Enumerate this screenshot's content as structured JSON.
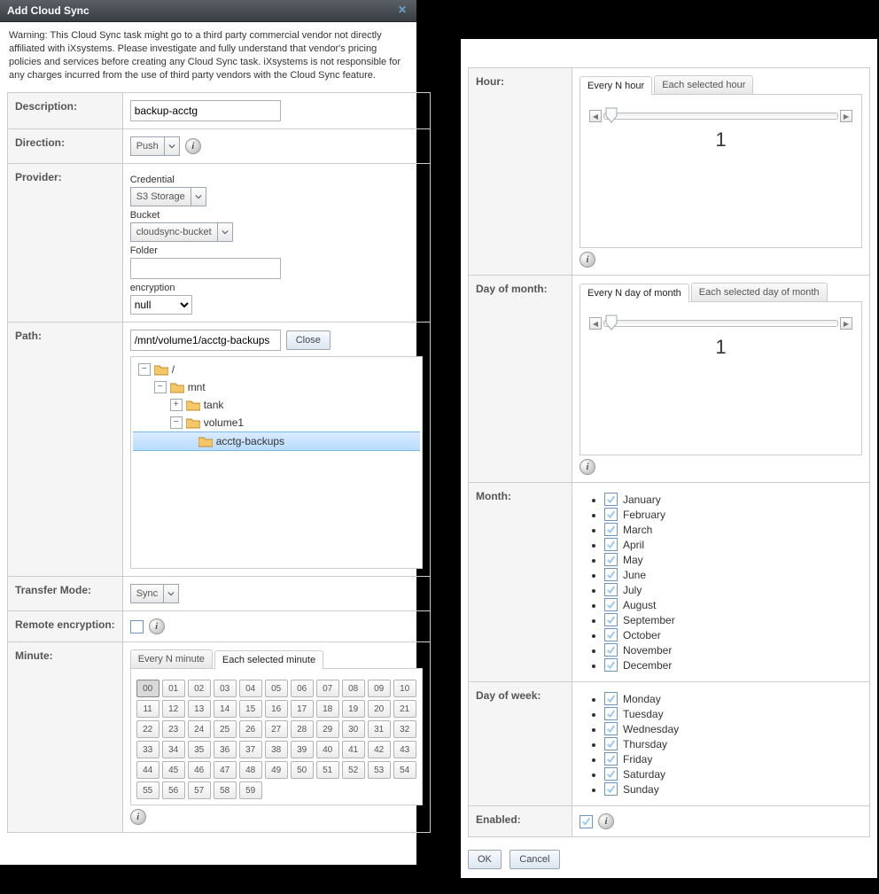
{
  "title": "Add Cloud Sync",
  "warning": "Warning: This Cloud Sync task might go to a third party commercial vendor not directly affiliated with iXsystems. Please investigate and fully understand that vendor's pricing policies and services before creating any Cloud Sync task. iXsystems is not responsible for any charges incurred from the use of third party vendors with the Cloud Sync feature.",
  "labels": {
    "description": "Description:",
    "direction": "Direction:",
    "provider": "Provider:",
    "path": "Path:",
    "transfer": "Transfer Mode:",
    "remote_enc": "Remote encryption:",
    "minute": "Minute:",
    "hour": "Hour:",
    "dom": "Day of month:",
    "month": "Month:",
    "dow": "Day of week:",
    "enabled": "Enabled:"
  },
  "provider": {
    "credential_label": "Credential",
    "credential_value": "S3 Storage",
    "bucket_label": "Bucket",
    "bucket_value": "cloudsync-bucket",
    "folder_label": "Folder",
    "folder_value": "",
    "encryption_label": "encryption",
    "encryption_value": "null"
  },
  "values": {
    "description": "backup-acctg",
    "direction": "Push",
    "path": "/mnt/volume1/acctg-backups",
    "close": "Close",
    "transfer": "Sync"
  },
  "tree": {
    "root": "/",
    "mnt": "mnt",
    "tank": "tank",
    "volume1": "volume1",
    "acctg": "acctg-backups"
  },
  "tabs": {
    "min_everyn": "Every N minute",
    "min_each": "Each selected minute",
    "hr_everyn": "Every N hour",
    "hr_each": "Each selected hour",
    "dom_everyn": "Every N day of month",
    "dom_each": "Each selected day of month"
  },
  "minutes": [
    "00",
    "01",
    "02",
    "03",
    "04",
    "05",
    "06",
    "07",
    "08",
    "09",
    "10",
    "11",
    "12",
    "13",
    "14",
    "15",
    "16",
    "17",
    "18",
    "19",
    "20",
    "21",
    "22",
    "23",
    "24",
    "25",
    "26",
    "27",
    "28",
    "29",
    "30",
    "31",
    "32",
    "33",
    "34",
    "35",
    "36",
    "37",
    "38",
    "39",
    "40",
    "41",
    "42",
    "43",
    "44",
    "45",
    "46",
    "47",
    "48",
    "49",
    "50",
    "51",
    "52",
    "53",
    "54",
    "55",
    "56",
    "57",
    "58",
    "59"
  ],
  "minute_selected": "00",
  "slider": {
    "hour": "1",
    "dom": "1"
  },
  "months": [
    "January",
    "February",
    "March",
    "April",
    "May",
    "June",
    "July",
    "August",
    "September",
    "October",
    "November",
    "December"
  ],
  "dows": [
    "Monday",
    "Tuesday",
    "Wednesday",
    "Thursday",
    "Friday",
    "Saturday",
    "Sunday"
  ],
  "buttons": {
    "ok": "OK",
    "cancel": "Cancel"
  }
}
